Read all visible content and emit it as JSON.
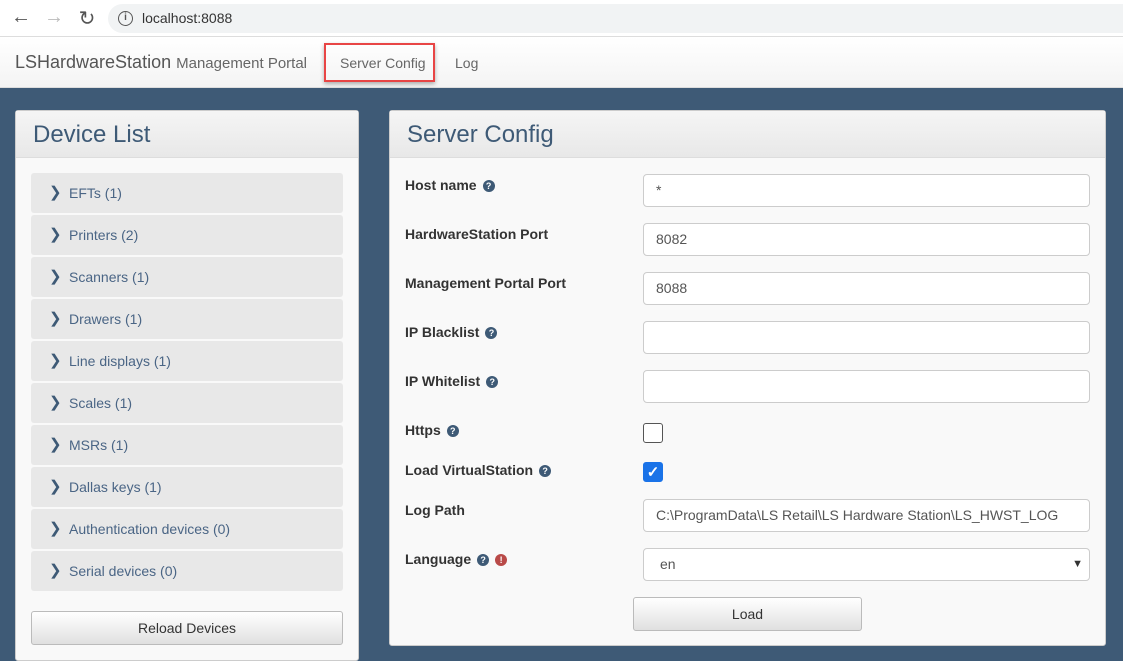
{
  "browser": {
    "url": "localhost:8088"
  },
  "navbar": {
    "brand": "LSHardwareStation",
    "brand_sub": "Management Portal",
    "links": [
      "Server Config",
      "Log"
    ]
  },
  "device_list": {
    "title": "Device List",
    "items": [
      "EFTs (1)",
      "Printers (2)",
      "Scanners (1)",
      "Drawers (1)",
      "Line displays (1)",
      "Scales (1)",
      "MSRs (1)",
      "Dallas keys (1)",
      "Authentication devices (0)",
      "Serial devices (0)"
    ],
    "reload_label": "Reload Devices"
  },
  "server_config": {
    "title": "Server Config",
    "host_name": {
      "label": "Host name",
      "value": "*"
    },
    "hws_port": {
      "label": "HardwareStation Port",
      "value": "8082"
    },
    "mp_port": {
      "label": "Management Portal Port",
      "value": "8088"
    },
    "ip_blacklist": {
      "label": "IP Blacklist",
      "value": ""
    },
    "ip_whitelist": {
      "label": "IP Whitelist",
      "value": ""
    },
    "https": {
      "label": "Https",
      "checked": false
    },
    "load_virtual": {
      "label": "Load VirtualStation",
      "checked": true
    },
    "log_path": {
      "label": "Log Path",
      "value": "C:\\ProgramData\\LS Retail\\LS Hardware Station\\LS_HWST_LOG"
    },
    "language": {
      "label": "Language",
      "value": "en"
    },
    "load_label": "Load"
  }
}
